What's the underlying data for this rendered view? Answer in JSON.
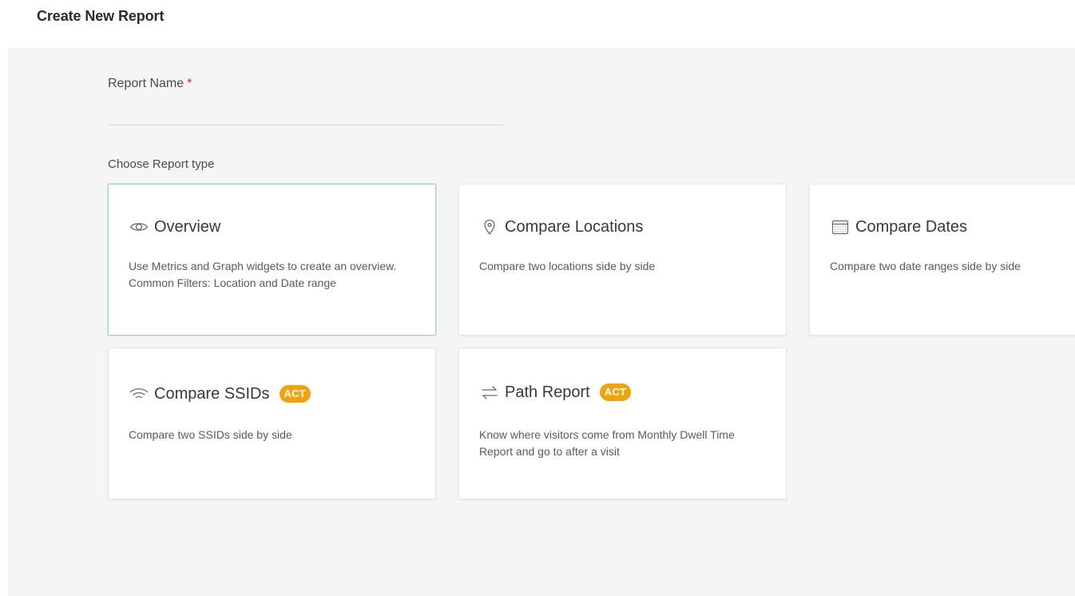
{
  "page": {
    "title": "Create New Report"
  },
  "form": {
    "report_name_label": "Report Name",
    "required_mark": "*",
    "report_name_value": "",
    "report_type_label": "Choose Report type"
  },
  "report_types": [
    {
      "title": "Overview",
      "icon": "eye-icon",
      "description": "Use Metrics and Graph widgets to create an overview. Common Filters: Location and Date range",
      "selected": true,
      "badge": ""
    },
    {
      "title": "Compare Locations",
      "icon": "location-pin-icon",
      "description": "Compare two locations side by side",
      "selected": false,
      "badge": ""
    },
    {
      "title": "Compare Dates",
      "icon": "calendar-icon",
      "description": "Compare two date ranges side by side",
      "selected": false,
      "badge": ""
    },
    {
      "title": "Compare SSIDs",
      "icon": "wifi-icon",
      "description": "Compare two SSIDs side by side",
      "selected": false,
      "badge": "ACT"
    },
    {
      "title": "Path Report",
      "icon": "swap-arrows-icon",
      "description": "Know where visitors come from Monthly Dwell Time Report and go to after a visit",
      "selected": false,
      "badge": "ACT"
    }
  ],
  "colors": {
    "panel_background": "#f5f5f5",
    "selected_border": "#9ccfe8",
    "badge": "#f0a30a",
    "required": "#e2231a"
  }
}
